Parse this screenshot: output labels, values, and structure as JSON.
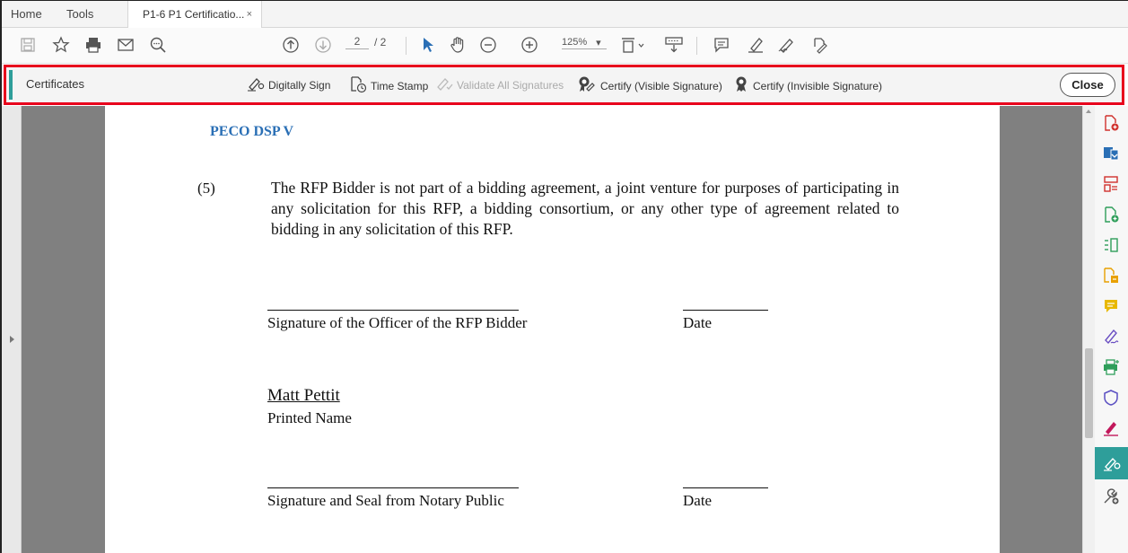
{
  "tabs": {
    "home": "Home",
    "tools": "Tools",
    "document": "P1-6 P1 Certificatio...",
    "close_glyph": "×"
  },
  "toolbar": {
    "page_current": "2",
    "page_total": "/ 2",
    "zoom": "125%",
    "zoom_caret": "▾"
  },
  "certbar": {
    "title": "Certificates",
    "digitally_sign": "Digitally Sign",
    "time_stamp": "Time Stamp",
    "validate_all": "Validate All Signatures",
    "certify_visible": "Certify (Visible Signature)",
    "certify_invisible": "Certify (Invisible Signature)",
    "close": "Close"
  },
  "document": {
    "header": "PECO DSP V",
    "item_number": "(5)",
    "paragraph": "The RFP Bidder is not part of a bidding agreement, a joint venture for purposes of participating in any solicitation for this RFP, a bidding consortium, or any other type of agreement related to bidding in any solicitation of this RFP.",
    "sig_officer_label": "Signature of the Officer of the RFP Bidder",
    "date_label_1": "Date",
    "printed_name_value": "Matt Pettit",
    "printed_name_label": "Printed Name",
    "sig_notary_label": "Signature and Seal from Notary Public",
    "date_label_2": "Date"
  },
  "colors": {
    "accent_teal": "#2e9e9a",
    "highlight_red": "#e8001c",
    "header_blue": "#2a6fb5"
  },
  "right_tools": [
    "export-pdf-icon",
    "create-pdf-icon",
    "organize-pages-icon",
    "edit-pdf-icon",
    "compare-icon",
    "combine-files-icon",
    "comment-icon",
    "fill-sign-icon",
    "print-production-icon",
    "protect-icon",
    "request-signature-icon",
    "certificates-icon",
    "more-tools-icon"
  ]
}
